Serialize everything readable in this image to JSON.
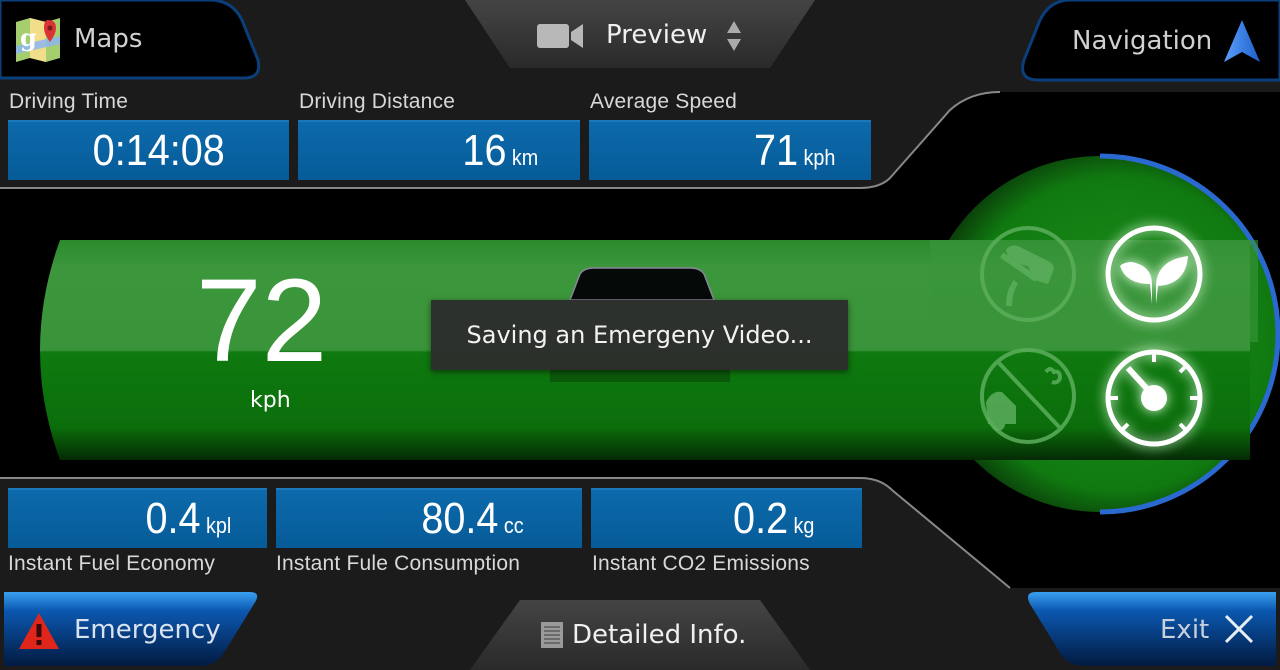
{
  "header": {
    "maps_label": "Maps",
    "preview_label": "Preview",
    "navigation_label": "Navigation"
  },
  "top_stats": [
    {
      "label": "Driving Time",
      "value": "0:14:08",
      "unit": ""
    },
    {
      "label": "Driving Distance",
      "value": "16",
      "unit": "km"
    },
    {
      "label": "Average Speed",
      "value": "71",
      "unit": "kph"
    }
  ],
  "speed": {
    "value": "72",
    "unit": "kph"
  },
  "toast": {
    "message": "Saving an Emergeny Video..."
  },
  "mode_icons": [
    {
      "name": "pedal-icon",
      "state": "inactive"
    },
    {
      "name": "eco-leaf-icon",
      "state": "active"
    },
    {
      "name": "no-idling-icon",
      "state": "inactive"
    },
    {
      "name": "speedometer-icon",
      "state": "active"
    }
  ],
  "bottom_stats": [
    {
      "label": "Instant Fuel Economy",
      "value": "0.4",
      "unit": "kpl"
    },
    {
      "label": "Instant Fule Consumption",
      "value": "80.4",
      "unit": "cc"
    },
    {
      "label": "Instant CO2 Emissions",
      "value": "0.2",
      "unit": "kg"
    }
  ],
  "footer": {
    "emergency_label": "Emergency",
    "detailed_info_label": "Detailed Info.",
    "exit_label": "Exit"
  },
  "colors": {
    "tile_blue": "#0a64a4",
    "eco_green": "#1a8f1a",
    "accent_blue": "#1f6fd0",
    "warning_red": "#e0251b"
  }
}
